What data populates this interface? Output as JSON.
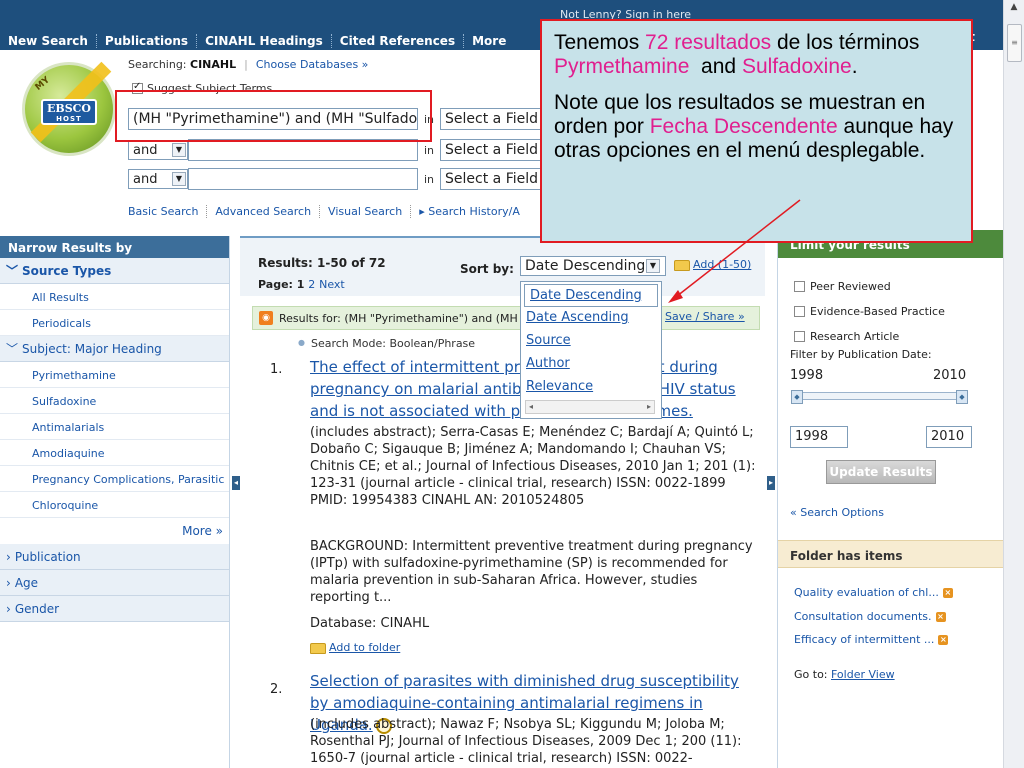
{
  "header": {
    "signin": "Not Lenny? Sign in here",
    "nav": [
      "New Search",
      "Publications",
      "CINAHL Headings",
      "Cited References",
      "More"
    ],
    "nav_right": "it",
    "corner": "RI"
  },
  "logo": {
    "my": "MY",
    "brand": "EBSCO",
    "host": "HOST"
  },
  "search": {
    "searching_label": "Searching:",
    "database": "CINAHL",
    "choose_db": "Choose Databases »",
    "suggest_label": "Suggest Subject Terms",
    "rows": [
      {
        "bool": "",
        "term": "(MH \"Pyrimethamine\") and (MH \"Sulfadoxi",
        "in": "in",
        "field": "Select a Field"
      },
      {
        "bool": "and",
        "term": "",
        "in": "in",
        "field": "Select a Field"
      },
      {
        "bool": "and",
        "term": "",
        "in": "in",
        "field": "Select a Field"
      }
    ],
    "links": [
      "Basic Search",
      "Advanced Search",
      "Visual Search",
      "▸ Search History/A"
    ]
  },
  "left": {
    "header": "Narrow Results by",
    "source_types": "Source Types",
    "source_items": [
      "All Results",
      "Periodicals"
    ],
    "subject_heading": "Subject: Major Heading",
    "subject_items": [
      "Pyrimethamine",
      "Sulfadoxine",
      "Antimalarials",
      "Amodiaquine",
      "Pregnancy Complications, Parasitic",
      "Chloroquine"
    ],
    "more": "More »",
    "collapsed": [
      "Publication",
      "Age",
      "Gender"
    ]
  },
  "results": {
    "count": "Results: 1-50 of 72",
    "page_label": "Page: 1",
    "page_2": "2",
    "next": "Next",
    "sort_label": "Sort by:",
    "sort_value": "Date Descending",
    "add": "Add (1-50)",
    "sort_options": [
      "Date Descending",
      "Date Ascending",
      "Source",
      "Author",
      "Relevance"
    ],
    "results_for": "Results for: (MH \"Pyrimethamine\") and (MH",
    "save_share": "Save / Share »",
    "search_mode": "Search Mode: Boolean/Phrase",
    "items": [
      {
        "num": "1.",
        "title": "The effect of intermittent preventive treatment during pregnancy on malarial antibodies depends on HIV status and is not associated with poor delivery outcomes.",
        "meta": "(includes abstract); Serra-Casas E; Menéndez C; Bardají A; Quintó L; Dobaño C; Sigauque B; Jiménez A; Mandomando I; Chauhan VS; Chitnis CE; et al.; Journal of Infectious Diseases, 2010 Jan 1; 201 (1): 123-31 (journal article - clinical trial, research) ISSN: 0022-1899 PMID: 19954383 CINAHL AN: 2010524805",
        "abstract": "BACKGROUND: Intermittent preventive treatment during pregnancy (IPTp) with sulfadoxine-pyrimethamine (SP) is recommended for malaria prevention in sub-Saharan Africa. However, studies reporting t...",
        "database": "Database: CINAHL",
        "add": "Add to folder"
      },
      {
        "num": "2.",
        "title": "Selection of parasites with diminished drug susceptibility by amodiaquine-containing antimalarial regimens in Uganda.",
        "meta": "(includes abstract); Nawaz F; Nsobya SL; Kiggundu M; Joloba M; Rosenthal PJ; Journal of Infectious Diseases, 2009 Dec 1; 200 (11): 1650-7 (journal article - clinical trial, research) ISSN: 0022-"
      }
    ]
  },
  "right": {
    "limit_head": "Limit your results",
    "options": [
      "Peer Reviewed",
      "Evidence-Based Practice",
      "Research Article"
    ],
    "filter_label": "Filter by Publication Date:",
    "year_from": "1998",
    "year_to": "2010",
    "update": "Update Results",
    "search_options": "« Search Options",
    "folder_head": "Folder has items",
    "folder_items": [
      "Quality evaluation of chl...",
      "Consultation documents.",
      "Efficacy of intermittent ..."
    ],
    "goto_label": "Go to:",
    "folder_view": "Folder View"
  },
  "callout": {
    "p1_a": "Tenemos ",
    "p1_count": "72 resultados",
    "p1_b": " de los términos ",
    "p1_t1": "Pyrmethamine",
    "p1_c": "  and ",
    "p1_t2": "Sulfadoxine",
    "p1_d": ".",
    "p2_a": "Note que los resultados se muestran en orden por ",
    "p2_order": "Fecha Descendente",
    "p2_b": " aunque hay otras opciones en el menú desplegable."
  },
  "colors": {
    "header_bg": "#1e4f7d",
    "accent_red": "#e11b22",
    "callout_bg": "#c7e2e9",
    "highlight_pink": "#e01f8f",
    "link": "#1a56a8"
  }
}
